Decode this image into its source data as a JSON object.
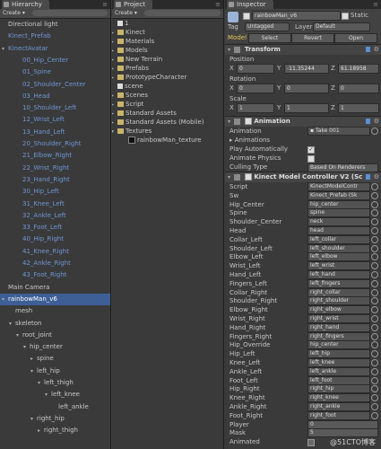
{
  "hierarchy": {
    "tab": "Hierarchy",
    "create": "Create",
    "items": [
      {
        "label": "Directional light",
        "indent": 0,
        "fold": "",
        "style": "normal"
      },
      {
        "label": "Kinect_Prefab",
        "indent": 0,
        "fold": "",
        "style": "blue"
      },
      {
        "label": "KinectAvatar",
        "indent": 0,
        "fold": "▾",
        "style": "blue"
      },
      {
        "label": "00_Hip_Center",
        "indent": 2,
        "fold": "",
        "style": "blue"
      },
      {
        "label": "01_Spine",
        "indent": 2,
        "fold": "",
        "style": "blue"
      },
      {
        "label": "02_Shoulder_Center",
        "indent": 2,
        "fold": "",
        "style": "blue"
      },
      {
        "label": "03_Head",
        "indent": 2,
        "fold": "",
        "style": "blue"
      },
      {
        "label": "10_Shoulder_Left",
        "indent": 2,
        "fold": "",
        "style": "blue"
      },
      {
        "label": "12_Wrist_Left",
        "indent": 2,
        "fold": "",
        "style": "blue"
      },
      {
        "label": "13_Hand_Left",
        "indent": 2,
        "fold": "",
        "style": "blue"
      },
      {
        "label": "20_Shoulder_Right",
        "indent": 2,
        "fold": "",
        "style": "blue"
      },
      {
        "label": "21_Elbow_Right",
        "indent": 2,
        "fold": "",
        "style": "blue"
      },
      {
        "label": "22_Wrist_Right",
        "indent": 2,
        "fold": "",
        "style": "blue"
      },
      {
        "label": "23_Hand_Right",
        "indent": 2,
        "fold": "",
        "style": "blue"
      },
      {
        "label": "30_Hip_Left",
        "indent": 2,
        "fold": "",
        "style": "blue"
      },
      {
        "label": "31_Knee_Left",
        "indent": 2,
        "fold": "",
        "style": "blue"
      },
      {
        "label": "32_Ankle_Left",
        "indent": 2,
        "fold": "",
        "style": "blue"
      },
      {
        "label": "33_Foot_Left",
        "indent": 2,
        "fold": "",
        "style": "blue"
      },
      {
        "label": "40_Hip_Right",
        "indent": 2,
        "fold": "",
        "style": "blue"
      },
      {
        "label": "41_Knee_Right",
        "indent": 2,
        "fold": "",
        "style": "blue"
      },
      {
        "label": "42_Ankle_Right",
        "indent": 2,
        "fold": "",
        "style": "blue"
      },
      {
        "label": "43_Foot_Right",
        "indent": 2,
        "fold": "",
        "style": "blue"
      },
      {
        "label": "Main Camera",
        "indent": 0,
        "fold": "",
        "style": "normal"
      },
      {
        "label": "rainbowMan_v6",
        "indent": 0,
        "fold": "▾",
        "style": "selected"
      },
      {
        "label": "mesh",
        "indent": 1,
        "fold": "",
        "style": "normal"
      },
      {
        "label": "skeleton",
        "indent": 1,
        "fold": "▾",
        "style": "normal"
      },
      {
        "label": "root_joint",
        "indent": 2,
        "fold": "▾",
        "style": "normal"
      },
      {
        "label": "hip_center",
        "indent": 3,
        "fold": "▾",
        "style": "normal"
      },
      {
        "label": "spine",
        "indent": 4,
        "fold": "▸",
        "style": "normal"
      },
      {
        "label": "left_hip",
        "indent": 4,
        "fold": "▾",
        "style": "normal"
      },
      {
        "label": "left_thigh",
        "indent": 5,
        "fold": "▾",
        "style": "normal"
      },
      {
        "label": "left_knee",
        "indent": 6,
        "fold": "▾",
        "style": "normal"
      },
      {
        "label": "left_ankle",
        "indent": 7,
        "fold": "",
        "style": "normal"
      },
      {
        "label": "right_hip",
        "indent": 4,
        "fold": "▾",
        "style": "normal"
      },
      {
        "label": "right_thigh",
        "indent": 5,
        "fold": "▸",
        "style": "normal"
      }
    ]
  },
  "project": {
    "tab": "Project",
    "create": "Create",
    "items": [
      {
        "label": "1",
        "indent": 0,
        "kind": "scene"
      },
      {
        "label": "Kinect",
        "indent": 0,
        "kind": "folder"
      },
      {
        "label": "Materials",
        "indent": 0,
        "kind": "folder"
      },
      {
        "label": "Models",
        "indent": 0,
        "kind": "folder"
      },
      {
        "label": "New Terrain",
        "indent": 0,
        "kind": "folder"
      },
      {
        "label": "Prefabs",
        "indent": 0,
        "kind": "folder"
      },
      {
        "label": "PrototypeCharacter",
        "indent": 0,
        "kind": "folder"
      },
      {
        "label": "scene",
        "indent": 0,
        "kind": "scene"
      },
      {
        "label": "Scenes",
        "indent": 0,
        "kind": "folder"
      },
      {
        "label": "Script",
        "indent": 0,
        "kind": "folder"
      },
      {
        "label": "Standard Assets",
        "indent": 0,
        "kind": "folder"
      },
      {
        "label": "Standard Assets (Mobile)",
        "indent": 0,
        "kind": "folder"
      },
      {
        "label": "Textures",
        "indent": 0,
        "kind": "folder-open"
      },
      {
        "label": "rainbowMan_texture",
        "indent": 1,
        "kind": "texture"
      }
    ]
  },
  "inspector": {
    "tab": "Inspector",
    "object_name": "rainbowMan_v6",
    "static_label": "Static",
    "tag_label": "Tag",
    "tag_value": "Untagged",
    "layer_label": "Layer",
    "layer_value": "Default",
    "model_label": "Model",
    "select_btn": "Select",
    "revert_btn": "Revert",
    "open_btn": "Open",
    "transform": {
      "header": "Transform",
      "position_label": "Position",
      "position": {
        "x": "0",
        "y": "-11.35244",
        "z": "61.18958"
      },
      "rotation_label": "Rotation",
      "rotation": {
        "x": "0",
        "y": "0",
        "z": "0"
      },
      "scale_label": "Scale",
      "scale": {
        "x": "1",
        "y": "1",
        "z": "1"
      }
    },
    "animation": {
      "header": "Animation",
      "rows": [
        {
          "label": "Animation",
          "value": "Take 001",
          "kind": "object"
        },
        {
          "label": "Animations",
          "value": "",
          "kind": "fold"
        },
        {
          "label": "Play Automatically",
          "value": "",
          "kind": "checkbox-on"
        },
        {
          "label": "Animate Physics",
          "value": "",
          "kind": "checkbox-off"
        },
        {
          "label": "Culling Type",
          "value": "Based On Renderers",
          "kind": "dropdown"
        }
      ]
    },
    "kinect": {
      "header": "Kinect Model Controller V2 (Sc",
      "rows": [
        {
          "label": "Script",
          "value": "KinectModelContr"
        },
        {
          "label": "Sw",
          "value": "Kinect_Prefab (Sk"
        },
        {
          "label": "Hip_Center",
          "value": "hip_center"
        },
        {
          "label": "Spine",
          "value": "spine"
        },
        {
          "label": "Shoulder_Center",
          "value": "neck"
        },
        {
          "label": "Head",
          "value": "head"
        },
        {
          "label": "Collar_Left",
          "value": "left_collar"
        },
        {
          "label": "Shoulder_Left",
          "value": "left_shoulder"
        },
        {
          "label": "Elbow_Left",
          "value": "left_elbow"
        },
        {
          "label": "Wrist_Left",
          "value": "left_wrist"
        },
        {
          "label": "Hand_Left",
          "value": "left_hand"
        },
        {
          "label": "Fingers_Left",
          "value": "left_fingers"
        },
        {
          "label": "Collar_Right",
          "value": "right_collar"
        },
        {
          "label": "Shoulder_Right",
          "value": "right_shoulder"
        },
        {
          "label": "Elbow_Right",
          "value": "right_elbow"
        },
        {
          "label": "Wrist_Right",
          "value": "right_wrist"
        },
        {
          "label": "Hand_Right",
          "value": "right_hand"
        },
        {
          "label": "Fingers_Right",
          "value": "right_fingers"
        },
        {
          "label": "Hip_Override",
          "value": "hip_center"
        },
        {
          "label": "Hip_Left",
          "value": "left_hip"
        },
        {
          "label": "Knee_Left",
          "value": "left_knee"
        },
        {
          "label": "Ankle_Left",
          "value": "left_ankle"
        },
        {
          "label": "Foot_Left",
          "value": "left_foot"
        },
        {
          "label": "Hip_Right",
          "value": "right_hip"
        },
        {
          "label": "Knee_Right",
          "value": "right_knee"
        },
        {
          "label": "Ankle_Right",
          "value": "right_ankle"
        },
        {
          "label": "Foot_Right",
          "value": "right_foot"
        },
        {
          "label": "Player",
          "value": "0"
        },
        {
          "label": "Mask",
          "value": "5"
        },
        {
          "label": "Animated",
          "value": ""
        }
      ]
    },
    "watermark": "@51CTO博客"
  }
}
